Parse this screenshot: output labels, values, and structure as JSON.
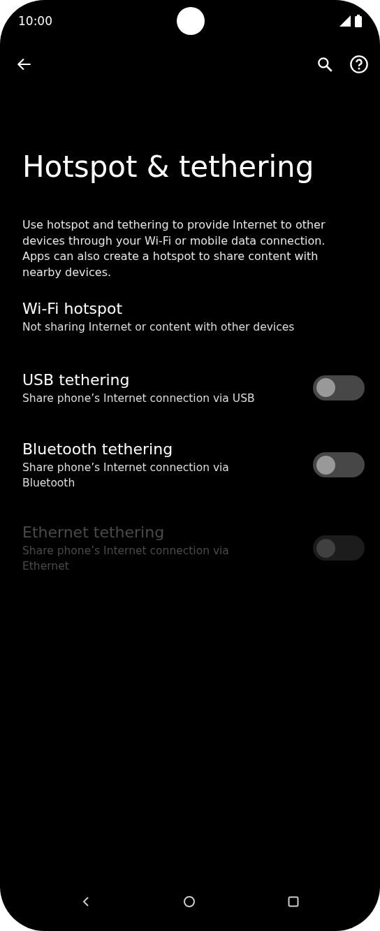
{
  "status_bar": {
    "time": "10:00"
  },
  "app_bar": {
    "title": "Hotspot & tethering",
    "description": "Use hotspot and tethering to provide Internet to other devices through your Wi-Fi or mobile data connection. Apps can also create a hotspot to share content with nearby devices."
  },
  "settings": [
    {
      "kind": "plain",
      "title": "Wi-Fi hotspot",
      "summary": "Not sharing Internet or content with other devices",
      "disabled": false
    },
    {
      "kind": "switch",
      "title": "USB tethering",
      "summary": "Share phone’s Internet connection via USB",
      "disabled": false,
      "on": false
    },
    {
      "kind": "switch",
      "title": "Bluetooth tethering",
      "summary": "Share phone’s Internet connection via Bluetooth",
      "disabled": false,
      "on": false
    },
    {
      "kind": "switch",
      "title": "Ethernet tethering",
      "summary": "Share phone’s Internet connection via Ethernet",
      "disabled": true,
      "on": false
    }
  ]
}
